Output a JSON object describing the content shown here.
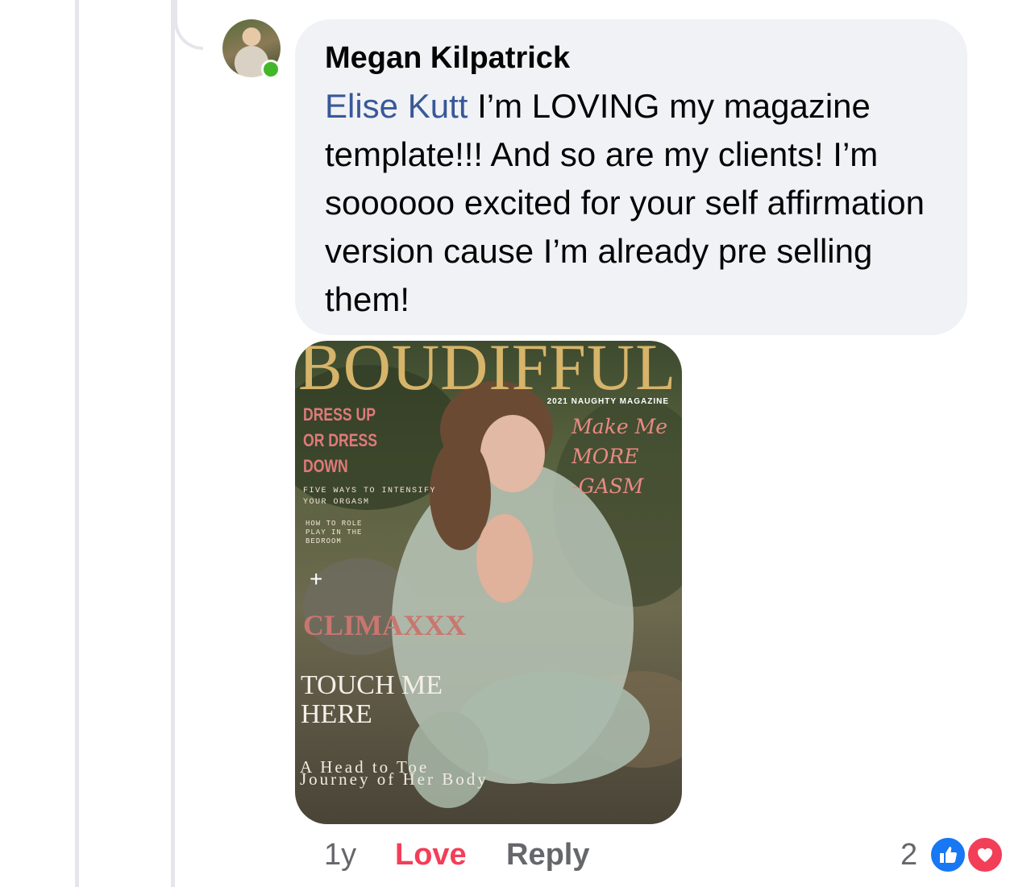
{
  "comment": {
    "author": "Megan Kilpatrick",
    "mention": "Elise Kutt",
    "text": " I’m LOVING my magazine template!!! And so are my clients! I’m soooooo excited for your self affirmation version cause I’m already pre selling them!"
  },
  "magazine": {
    "title": "BOUDIFFUL",
    "issue": "2021 NAUGHTY MAGAZINE",
    "headline_script": [
      "Make Me",
      "MORE",
      "-GASM"
    ],
    "dress": [
      "DRESS UP",
      "OR DRESS",
      "DOWN"
    ],
    "five_ways": [
      "FIVE WAYS TO INTENSIFY",
      "YOUR ORGASM"
    ],
    "role_play": [
      "HOW TO ROLE",
      "PLAY IN THE",
      "BEDROOM"
    ],
    "plus": "+",
    "climax": "CLIMAXXX",
    "touch": [
      "TOUCH ME",
      "HERE"
    ],
    "journey": [
      "A Head to Toe",
      "Journey of Her Body"
    ]
  },
  "actions": {
    "time": "1y",
    "love": "Love",
    "reply": "Reply"
  },
  "reactions": {
    "count": "2",
    "icons": [
      "like-icon",
      "love-icon"
    ]
  },
  "colors": {
    "bubble": "#f0f2f5",
    "mention": "#385898",
    "love": "#f33e58",
    "like": "#1877f2",
    "online": "#42b72a"
  }
}
